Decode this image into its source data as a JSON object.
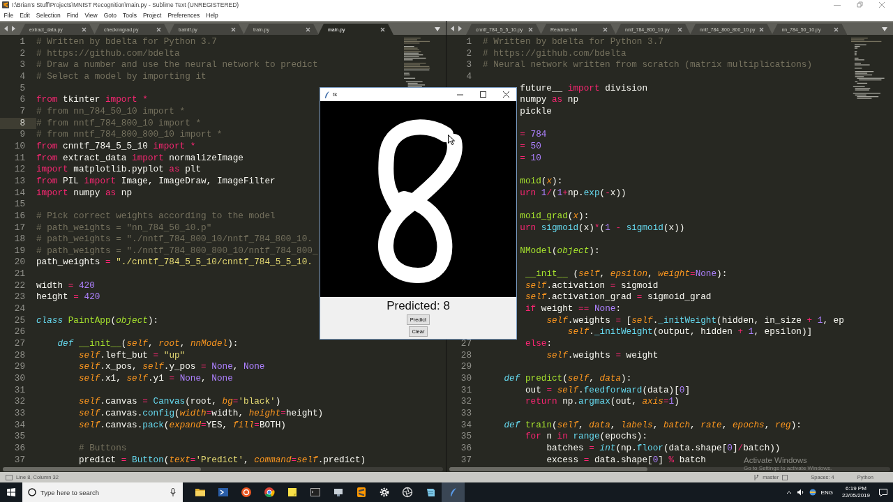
{
  "window": {
    "title": "I:\\Brian's Stuff\\Projects\\MNIST Recognition\\main.py - Sublime Text (UNREGISTERED)"
  },
  "menu": [
    "File",
    "Edit",
    "Selection",
    "Find",
    "View",
    "Goto",
    "Tools",
    "Project",
    "Preferences",
    "Help"
  ],
  "panes": [
    {
      "tabs": [
        {
          "label": "extract_data.py",
          "selected": false
        },
        {
          "label": "checknngrad.py",
          "selected": false
        },
        {
          "label": "traintf.py",
          "selected": false
        },
        {
          "label": "train.py",
          "selected": false
        },
        {
          "label": "main.py",
          "selected": true
        }
      ],
      "lines": [
        {
          "number": "1",
          "current": false,
          "tokens": [
            {
              "kind": "comment",
              "text": "# Written by bdelta for Python 3.7"
            }
          ]
        },
        {
          "number": "2",
          "current": false,
          "tokens": [
            {
              "kind": "comment",
              "text": "# https://github.com/bdelta"
            }
          ]
        },
        {
          "number": "3",
          "current": false,
          "tokens": [
            {
              "kind": "comment",
              "text": "# Draw a number and use the neural network to predict"
            }
          ]
        },
        {
          "number": "4",
          "current": false,
          "tokens": [
            {
              "kind": "comment",
              "text": "# Select a model by importing it"
            }
          ]
        },
        {
          "number": "5",
          "current": false
        },
        {
          "number": "6",
          "current": false,
          "tokens": [
            {
              "kind": "keyword",
              "text": "from"
            },
            {
              "kind": "plain",
              "text": " tkinter "
            },
            {
              "kind": "keyword",
              "text": "import"
            },
            {
              "kind": "keyword",
              "text": " *"
            }
          ]
        },
        {
          "number": "7",
          "current": false,
          "tokens": [
            {
              "kind": "comment",
              "text": "# from nn_784_50_10 import *"
            }
          ]
        },
        {
          "number": "8",
          "current": true,
          "tokens": [
            {
              "kind": "comment",
              "text": "# from nntf_784_800_10 import *"
            }
          ]
        },
        {
          "number": "9",
          "current": false,
          "tokens": [
            {
              "kind": "comment",
              "text": "# from nntf_784_800_800_10 import *"
            }
          ]
        },
        {
          "number": "10",
          "current": false,
          "tokens": [
            {
              "kind": "keyword",
              "text": "from"
            },
            {
              "kind": "plain",
              "text": " cnntf_784_5_5_10 "
            },
            {
              "kind": "keyword",
              "text": "import"
            },
            {
              "kind": "keyword",
              "text": " *"
            }
          ]
        },
        {
          "number": "11",
          "current": false,
          "tokens": [
            {
              "kind": "keyword",
              "text": "from"
            },
            {
              "kind": "plain",
              "text": " extract_data "
            },
            {
              "kind": "keyword",
              "text": "import"
            },
            {
              "kind": "plain",
              "text": " normalizeImage"
            }
          ]
        },
        {
          "number": "12",
          "current": false,
          "tokens": [
            {
              "kind": "keyword",
              "text": "import"
            },
            {
              "kind": "plain",
              "text": " matplotlib.pyplot "
            },
            {
              "kind": "keyword",
              "text": "as"
            },
            {
              "kind": "plain",
              "text": " plt"
            }
          ]
        },
        {
          "number": "13",
          "current": false,
          "tokens": [
            {
              "kind": "keyword",
              "text": "from"
            },
            {
              "kind": "plain",
              "text": " PIL "
            },
            {
              "kind": "keyword",
              "text": "import"
            },
            {
              "kind": "plain",
              "text": " Image, ImageDraw, ImageFilter"
            }
          ]
        },
        {
          "number": "14",
          "current": false,
          "tokens": [
            {
              "kind": "keyword",
              "text": "import"
            },
            {
              "kind": "plain",
              "text": " numpy "
            },
            {
              "kind": "keyword",
              "text": "as"
            },
            {
              "kind": "plain",
              "text": " np"
            }
          ]
        },
        {
          "number": "15",
          "current": false
        },
        {
          "number": "16",
          "current": false,
          "tokens": [
            {
              "kind": "comment",
              "text": "# Pick correct weights according to the model"
            }
          ]
        },
        {
          "number": "17",
          "current": false,
          "tokens": [
            {
              "kind": "comment",
              "text": "# path_weights = \"nn_784_50_10.p\""
            }
          ]
        },
        {
          "number": "18",
          "current": false,
          "tokens": [
            {
              "kind": "comment",
              "text": "# path_weights = \"./nntf_784_800_10/nntf_784_800_10."
            }
          ]
        },
        {
          "number": "19",
          "current": false,
          "tokens": [
            {
              "kind": "comment",
              "text": "# path_weights = \"./nntf_784_800_800_10/nntf_784_800_"
            }
          ]
        },
        {
          "number": "20",
          "current": false,
          "tokens": [
            {
              "kind": "plain",
              "text": "path_weights "
            },
            {
              "kind": "keyword",
              "text": "="
            },
            {
              "kind": "string",
              "text": " \"./cnntf_784_5_5_10/cnntf_784_5_5_10."
            }
          ]
        },
        {
          "number": "21",
          "current": false
        },
        {
          "number": "22",
          "current": false,
          "tokens": [
            {
              "kind": "plain",
              "text": "width "
            },
            {
              "kind": "keyword",
              "text": "="
            },
            {
              "kind": "number",
              "text": " 420"
            }
          ]
        },
        {
          "number": "23",
          "current": false,
          "tokens": [
            {
              "kind": "plain",
              "text": "height "
            },
            {
              "kind": "keyword",
              "text": "="
            },
            {
              "kind": "number",
              "text": " 420"
            }
          ]
        },
        {
          "number": "24",
          "current": false
        },
        {
          "number": "25",
          "current": false,
          "tokens": [
            {
              "kind": "storage",
              "text": "class"
            },
            {
              "kind": "entity",
              "text": " PaintApp"
            },
            {
              "kind": "plain",
              "text": "("
            },
            {
              "kind": "inherit",
              "text": "object"
            },
            {
              "kind": "plain",
              "text": "):"
            }
          ]
        },
        {
          "number": "26",
          "current": false
        },
        {
          "number": "27",
          "current": false,
          "tokens": [
            {
              "kind": "storage",
              "text": "    def"
            },
            {
              "kind": "entity",
              "text": " __init__"
            },
            {
              "kind": "plain",
              "text": "("
            },
            {
              "kind": "parameter",
              "text": "self"
            },
            {
              "kind": "plain",
              "text": ", "
            },
            {
              "kind": "parameter",
              "text": "root"
            },
            {
              "kind": "plain",
              "text": ", "
            },
            {
              "kind": "parameter",
              "text": "nnModel"
            },
            {
              "kind": "plain",
              "text": "):"
            }
          ]
        },
        {
          "number": "28",
          "current": false,
          "tokens": [
            {
              "kind": "parameter",
              "text": "        self"
            },
            {
              "kind": "plain",
              "text": ".left_but "
            },
            {
              "kind": "keyword",
              "text": "="
            },
            {
              "kind": "string",
              "text": " \"up\""
            }
          ]
        },
        {
          "number": "29",
          "current": false,
          "tokens": [
            {
              "kind": "parameter",
              "text": "        self"
            },
            {
              "kind": "plain",
              "text": ".x_pos, "
            },
            {
              "kind": "parameter",
              "text": "self"
            },
            {
              "kind": "plain",
              "text": ".y_pos "
            },
            {
              "kind": "keyword",
              "text": "="
            },
            {
              "kind": "constant",
              "text": " None"
            },
            {
              "kind": "plain",
              "text": ", "
            },
            {
              "kind": "constant",
              "text": "None"
            }
          ]
        },
        {
          "number": "30",
          "current": false,
          "tokens": [
            {
              "kind": "parameter",
              "text": "        self"
            },
            {
              "kind": "plain",
              "text": ".x1, "
            },
            {
              "kind": "parameter",
              "text": "self"
            },
            {
              "kind": "plain",
              "text": ".y1 "
            },
            {
              "kind": "keyword",
              "text": "="
            },
            {
              "kind": "constant",
              "text": " None"
            },
            {
              "kind": "plain",
              "text": ", "
            },
            {
              "kind": "constant",
              "text": "None"
            }
          ]
        },
        {
          "number": "31",
          "current": false
        },
        {
          "number": "32",
          "current": false,
          "tokens": [
            {
              "kind": "parameter",
              "text": "        self"
            },
            {
              "kind": "plain",
              "text": ".canvas "
            },
            {
              "kind": "keyword",
              "text": "="
            },
            {
              "kind": "function",
              "text": " Canvas"
            },
            {
              "kind": "plain",
              "text": "(root, "
            },
            {
              "kind": "parameter",
              "text": "bg"
            },
            {
              "kind": "keyword",
              "text": "="
            },
            {
              "kind": "string",
              "text": "'black'"
            },
            {
              "kind": "plain",
              "text": ")"
            }
          ]
        },
        {
          "number": "33",
          "current": false,
          "tokens": [
            {
              "kind": "parameter",
              "text": "        self"
            },
            {
              "kind": "plain",
              "text": ".canvas."
            },
            {
              "kind": "function",
              "text": "config"
            },
            {
              "kind": "plain",
              "text": "("
            },
            {
              "kind": "parameter",
              "text": "width"
            },
            {
              "kind": "keyword",
              "text": "="
            },
            {
              "kind": "plain",
              "text": "width, "
            },
            {
              "kind": "parameter",
              "text": "height"
            },
            {
              "kind": "keyword",
              "text": "="
            },
            {
              "kind": "plain",
              "text": "height)"
            }
          ]
        },
        {
          "number": "34",
          "current": false,
          "tokens": [
            {
              "kind": "parameter",
              "text": "        self"
            },
            {
              "kind": "plain",
              "text": ".canvas."
            },
            {
              "kind": "function",
              "text": "pack"
            },
            {
              "kind": "plain",
              "text": "("
            },
            {
              "kind": "parameter",
              "text": "expand"
            },
            {
              "kind": "keyword",
              "text": "="
            },
            {
              "kind": "plain",
              "text": "YES, "
            },
            {
              "kind": "parameter",
              "text": "fill"
            },
            {
              "kind": "keyword",
              "text": "="
            },
            {
              "kind": "plain",
              "text": "BOTH)"
            }
          ]
        },
        {
          "number": "35",
          "current": false
        },
        {
          "number": "36",
          "current": false,
          "tokens": [
            {
              "kind": "comment",
              "text": "        # Buttons"
            }
          ]
        },
        {
          "number": "37",
          "current": false,
          "tokens": [
            {
              "kind": "plain",
              "text": "        predict "
            },
            {
              "kind": "keyword",
              "text": "="
            },
            {
              "kind": "function",
              "text": " Button"
            },
            {
              "kind": "plain",
              "text": "("
            },
            {
              "kind": "parameter",
              "text": "text"
            },
            {
              "kind": "keyword",
              "text": "="
            },
            {
              "kind": "string",
              "text": "'Predict'"
            },
            {
              "kind": "plain",
              "text": ", "
            },
            {
              "kind": "parameter",
              "text": "command"
            },
            {
              "kind": "keyword",
              "text": "="
            },
            {
              "kind": "parameter",
              "text": "self"
            },
            {
              "kind": "plain",
              "text": ".predict)"
            }
          ]
        }
      ]
    },
    {
      "tabs": [
        {
          "label": "cnntf_784_5_5_10.py",
          "selected": false
        },
        {
          "label": "Readme.md",
          "selected": false
        },
        {
          "label": "nntf_784_800_10.py",
          "selected": false
        },
        {
          "label": "nntf_784_800_800_10.py",
          "selected": false
        },
        {
          "label": "nn_784_50_10.py",
          "selected": false
        }
      ],
      "lines": [
        {
          "number": "1",
          "current": false,
          "tokens": [
            {
              "kind": "comment",
              "text": "# Written by bdelta for Python 3.7"
            }
          ]
        },
        {
          "number": "2",
          "current": false,
          "tokens": [
            {
              "kind": "comment",
              "text": "# https://github.com/bdelta"
            }
          ]
        },
        {
          "number": "3",
          "current": false,
          "tokens": [
            {
              "kind": "comment",
              "text": "# Neural network written from scratch (matrix multiplications)"
            }
          ]
        },
        {
          "number": "4",
          "current": false
        },
        {
          "tokens": [
            {
              "kind": "plain",
              "text": "       future__ "
            },
            {
              "kind": "keyword",
              "text": "import"
            },
            {
              "kind": "plain",
              "text": " division"
            }
          ]
        },
        {
          "tokens": [
            {
              "kind": "plain",
              "text": "       numpy "
            },
            {
              "kind": "keyword",
              "text": "as"
            },
            {
              "kind": "plain",
              "text": " np"
            }
          ]
        },
        {
          "tokens": [
            {
              "kind": "plain",
              "text": "       pickle"
            }
          ]
        },
        {
          "kind": "blank"
        },
        {
          "tokens": [
            {
              "kind": "keyword",
              "text": "       ="
            },
            {
              "kind": "number",
              "text": " 784"
            }
          ]
        },
        {
          "tokens": [
            {
              "kind": "keyword",
              "text": "       ="
            },
            {
              "kind": "number",
              "text": " 50"
            }
          ]
        },
        {
          "tokens": [
            {
              "kind": "keyword",
              "text": "       ="
            },
            {
              "kind": "number",
              "text": " 10"
            }
          ]
        },
        {
          "kind": "blank"
        },
        {
          "tokens": [
            {
              "kind": "entity",
              "text": "       moid"
            },
            {
              "kind": "plain",
              "text": "("
            },
            {
              "kind": "parameter",
              "text": "x"
            },
            {
              "kind": "plain",
              "text": "):"
            }
          ]
        },
        {
          "tokens": [
            {
              "kind": "keyword",
              "text": "       urn"
            },
            {
              "kind": "number",
              "text": " 1"
            },
            {
              "kind": "keyword",
              "text": "/"
            },
            {
              "kind": "plain",
              "text": "("
            },
            {
              "kind": "number",
              "text": "1"
            },
            {
              "kind": "keyword",
              "text": "+"
            },
            {
              "kind": "plain",
              "text": "np."
            },
            {
              "kind": "function",
              "text": "exp"
            },
            {
              "kind": "plain",
              "text": "("
            },
            {
              "kind": "keyword",
              "text": "-"
            },
            {
              "kind": "plain",
              "text": "x))"
            }
          ]
        },
        {
          "kind": "blank"
        },
        {
          "tokens": [
            {
              "kind": "entity",
              "text": "       moid_grad"
            },
            {
              "kind": "plain",
              "text": "("
            },
            {
              "kind": "parameter",
              "text": "x"
            },
            {
              "kind": "plain",
              "text": "):"
            }
          ]
        },
        {
          "tokens": [
            {
              "kind": "keyword",
              "text": "       urn"
            },
            {
              "kind": "function",
              "text": " sigmoid"
            },
            {
              "kind": "plain",
              "text": "(x)"
            },
            {
              "kind": "keyword",
              "text": "*"
            },
            {
              "kind": "plain",
              "text": "("
            },
            {
              "kind": "number",
              "text": "1"
            },
            {
              "kind": "keyword",
              "text": " -"
            },
            {
              "kind": "function",
              "text": " sigmoid"
            },
            {
              "kind": "plain",
              "text": "(x))"
            }
          ]
        },
        {
          "kind": "blank"
        },
        {
          "tokens": [
            {
              "kind": "entity",
              "text": "       NModel"
            },
            {
              "kind": "plain",
              "text": "("
            },
            {
              "kind": "inherit",
              "text": "object"
            },
            {
              "kind": "plain",
              "text": "):"
            }
          ]
        },
        {
          "kind": "blank"
        },
        {
          "tokens": [
            {
              "kind": "entity",
              "text": "        __init__"
            },
            {
              "kind": "plain",
              "text": " ("
            },
            {
              "kind": "parameter",
              "text": "self"
            },
            {
              "kind": "plain",
              "text": ", "
            },
            {
              "kind": "parameter",
              "text": "epsilon"
            },
            {
              "kind": "plain",
              "text": ", "
            },
            {
              "kind": "parameter",
              "text": "weight"
            },
            {
              "kind": "keyword",
              "text": "="
            },
            {
              "kind": "constant",
              "text": "None"
            },
            {
              "kind": "plain",
              "text": "):"
            }
          ]
        },
        {
          "tokens": [
            {
              "kind": "parameter",
              "text": "        self"
            },
            {
              "kind": "plain",
              "text": ".activation "
            },
            {
              "kind": "keyword",
              "text": "="
            },
            {
              "kind": "plain",
              "text": " sigmoid"
            }
          ]
        },
        {
          "tokens": [
            {
              "kind": "parameter",
              "text": "        self"
            },
            {
              "kind": "plain",
              "text": ".activation_grad "
            },
            {
              "kind": "keyword",
              "text": "="
            },
            {
              "kind": "plain",
              "text": " sigmoid_grad"
            }
          ]
        },
        {
          "tokens": [
            {
              "kind": "keyword",
              "text": "        if"
            },
            {
              "kind": "plain",
              "text": " weight "
            },
            {
              "kind": "keyword",
              "text": "=="
            },
            {
              "kind": "constant",
              "text": " None"
            },
            {
              "kind": "plain",
              "text": ":"
            }
          ]
        },
        {
          "tokens": [
            {
              "kind": "parameter",
              "text": "            self"
            },
            {
              "kind": "plain",
              "text": ".weights "
            },
            {
              "kind": "keyword",
              "text": "="
            },
            {
              "kind": "plain",
              "text": " ["
            },
            {
              "kind": "parameter",
              "text": "self"
            },
            {
              "kind": "plain",
              "text": "."
            },
            {
              "kind": "function",
              "text": "_initWeight"
            },
            {
              "kind": "plain",
              "text": "(hidden, in_size "
            },
            {
              "kind": "keyword",
              "text": "+"
            },
            {
              "kind": "number",
              "text": " 1"
            },
            {
              "kind": "plain",
              "text": ", ep"
            }
          ]
        },
        {
          "tokens": [
            {
              "kind": "parameter",
              "text": "                self"
            },
            {
              "kind": "plain",
              "text": "."
            },
            {
              "kind": "function",
              "text": "_initWeight"
            },
            {
              "kind": "plain",
              "text": "(output, hidden "
            },
            {
              "kind": "keyword",
              "text": "+"
            },
            {
              "kind": "number",
              "text": " 1"
            },
            {
              "kind": "plain",
              "text": ", epsilon)]"
            }
          ]
        },
        {
          "number": "27",
          "current": false,
          "tokens": [
            {
              "kind": "keyword",
              "text": "        else"
            },
            {
              "kind": "plain",
              "text": ":"
            }
          ]
        },
        {
          "number": "28",
          "current": false,
          "tokens": [
            {
              "kind": "parameter",
              "text": "            self"
            },
            {
              "kind": "plain",
              "text": ".weights "
            },
            {
              "kind": "keyword",
              "text": "="
            },
            {
              "kind": "plain",
              "text": " weight"
            }
          ]
        },
        {
          "number": "29",
          "current": false
        },
        {
          "number": "30",
          "current": false,
          "tokens": [
            {
              "kind": "storage",
              "text": "    def"
            },
            {
              "kind": "entity",
              "text": " predict"
            },
            {
              "kind": "plain",
              "text": "("
            },
            {
              "kind": "parameter",
              "text": "self"
            },
            {
              "kind": "plain",
              "text": ", "
            },
            {
              "kind": "parameter",
              "text": "data"
            },
            {
              "kind": "plain",
              "text": "):"
            }
          ]
        },
        {
          "number": "31",
          "current": false,
          "tokens": [
            {
              "kind": "plain",
              "text": "        out "
            },
            {
              "kind": "keyword",
              "text": "="
            },
            {
              "kind": "parameter",
              "text": " self"
            },
            {
              "kind": "plain",
              "text": "."
            },
            {
              "kind": "function",
              "text": "feedforward"
            },
            {
              "kind": "plain",
              "text": "(data)["
            },
            {
              "kind": "number",
              "text": "0"
            },
            {
              "kind": "plain",
              "text": "]"
            }
          ]
        },
        {
          "number": "32",
          "current": false,
          "tokens": [
            {
              "kind": "keyword",
              "text": "        return"
            },
            {
              "kind": "plain",
              "text": " np."
            },
            {
              "kind": "function",
              "text": "argmax"
            },
            {
              "kind": "plain",
              "text": "(out, "
            },
            {
              "kind": "parameter",
              "text": "axis"
            },
            {
              "kind": "keyword",
              "text": "="
            },
            {
              "kind": "number",
              "text": "1"
            },
            {
              "kind": "plain",
              "text": ")"
            }
          ]
        },
        {
          "number": "33",
          "current": false
        },
        {
          "number": "34",
          "current": false,
          "tokens": [
            {
              "kind": "storage",
              "text": "    def"
            },
            {
              "kind": "entity",
              "text": " train"
            },
            {
              "kind": "plain",
              "text": "("
            },
            {
              "kind": "parameter",
              "text": "self"
            },
            {
              "kind": "plain",
              "text": ", "
            },
            {
              "kind": "parameter",
              "text": "data"
            },
            {
              "kind": "plain",
              "text": ", "
            },
            {
              "kind": "parameter",
              "text": "labels"
            },
            {
              "kind": "plain",
              "text": ", "
            },
            {
              "kind": "parameter",
              "text": "batch"
            },
            {
              "kind": "plain",
              "text": ", "
            },
            {
              "kind": "parameter",
              "text": "rate"
            },
            {
              "kind": "plain",
              "text": ", "
            },
            {
              "kind": "parameter",
              "text": "epochs"
            },
            {
              "kind": "plain",
              "text": ", "
            },
            {
              "kind": "parameter",
              "text": "reg"
            },
            {
              "kind": "plain",
              "text": "):"
            }
          ]
        },
        {
          "number": "35",
          "current": false,
          "tokens": [
            {
              "kind": "keyword",
              "text": "        for"
            },
            {
              "kind": "plain",
              "text": " n "
            },
            {
              "kind": "keyword",
              "text": "in"
            },
            {
              "kind": "function",
              "text": " range"
            },
            {
              "kind": "plain",
              "text": "(epochs):"
            }
          ]
        },
        {
          "number": "36",
          "current": false,
          "tokens": [
            {
              "kind": "plain",
              "text": "            batches "
            },
            {
              "kind": "keyword",
              "text": "="
            },
            {
              "kind": "storage",
              "text": " int"
            },
            {
              "kind": "plain",
              "text": "(np."
            },
            {
              "kind": "function",
              "text": "floor"
            },
            {
              "kind": "plain",
              "text": "(data.shape["
            },
            {
              "kind": "number",
              "text": "0"
            },
            {
              "kind": "plain",
              "text": "]"
            },
            {
              "kind": "keyword",
              "text": "/"
            },
            {
              "kind": "plain",
              "text": "batch))"
            }
          ]
        },
        {
          "number": "37",
          "current": false,
          "tokens": [
            {
              "kind": "plain",
              "text": "            excess "
            },
            {
              "kind": "keyword",
              "text": "="
            },
            {
              "kind": "plain",
              "text": " data.shape["
            },
            {
              "kind": "number",
              "text": "0"
            },
            {
              "kind": "plain",
              "text": "] "
            },
            {
              "kind": "keyword",
              "text": "%"
            },
            {
              "kind": "plain",
              "text": " batch"
            }
          ]
        }
      ]
    }
  ],
  "tk_window": {
    "title": "tk",
    "prediction": "Predicted: 8",
    "buttons": [
      "Predict",
      "Clear"
    ]
  },
  "activation_notice": {
    "title": "Activate Windows",
    "hint": "Go to Settings to activate Windows."
  },
  "status_bar": {
    "position": "Line 8, Column 32",
    "branch": "master",
    "indentation": "Spaces: 4",
    "syntax": "Python"
  },
  "taskbar": {
    "search": {
      "placeholder": "Type here to search"
    },
    "apps": [
      {
        "active": false
      },
      {
        "active": false
      },
      {
        "active": false
      },
      {
        "active": false
      },
      {
        "active": false
      },
      {
        "active": false
      },
      {
        "active": false
      },
      {
        "active": false
      },
      {
        "active": false
      },
      {
        "active": false
      },
      {
        "active": false
      },
      {
        "active": true
      }
    ],
    "language": "ENG",
    "time": "6:19 PM",
    "date": "22/05/2019"
  }
}
